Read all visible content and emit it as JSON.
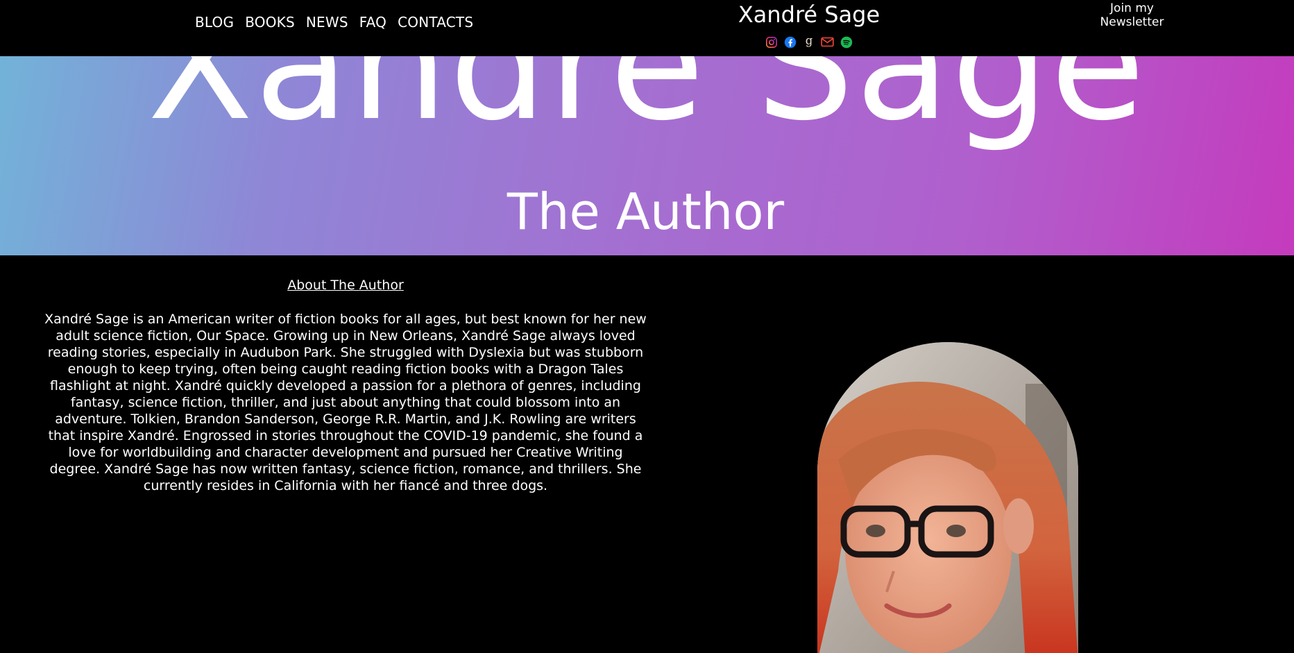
{
  "header": {
    "nav": [
      "BLOG",
      "BOOKS",
      "NEWS",
      "FAQ",
      "CONTACTS"
    ],
    "site_title": "Xandré Sage",
    "socials": [
      "instagram-icon",
      "facebook-icon",
      "goodreads-icon",
      "email-icon",
      "spotify-icon"
    ],
    "newsletter_line1": "Join my",
    "newsletter_line2": "Newsletter"
  },
  "hero": {
    "title": "Xandré Sage",
    "subtitle": "The Author"
  },
  "about": {
    "heading": "About The Author",
    "body": "Xandré Sage is an American writer of fiction books for all ages, but best known for her new adult science fiction, Our Space. Growing up in New Orleans, Xandré Sage always loved reading stories, especially in Audubon Park. She struggled with Dyslexia but was stubborn enough to keep trying, often being caught reading fiction books with a Dragon Tales flashlight at night. Xandré quickly developed a passion for a plethora of genres, including fantasy, science fiction, thriller, and just about anything that could blossom into an adventure. Tolkien, Brandon Sanderson, George R.R. Martin, and J.K. Rowling are writers that inspire Xandré. Engrossed in stories throughout the COVID-19 pandemic, she found a love for worldbuilding and character development and pursued her Creative Writing degree. Xandré Sage has now written fantasy, science fiction, romance, and thrillers. She currently resides in California with her fiancé and three dogs."
  },
  "colors": {
    "background": "#000000",
    "gradient_start": "#72b3d8",
    "gradient_end": "#c43bbd",
    "instagram": "#e1306c",
    "facebook": "#1877f2",
    "email": "#ea4335",
    "spotify": "#1db954"
  }
}
